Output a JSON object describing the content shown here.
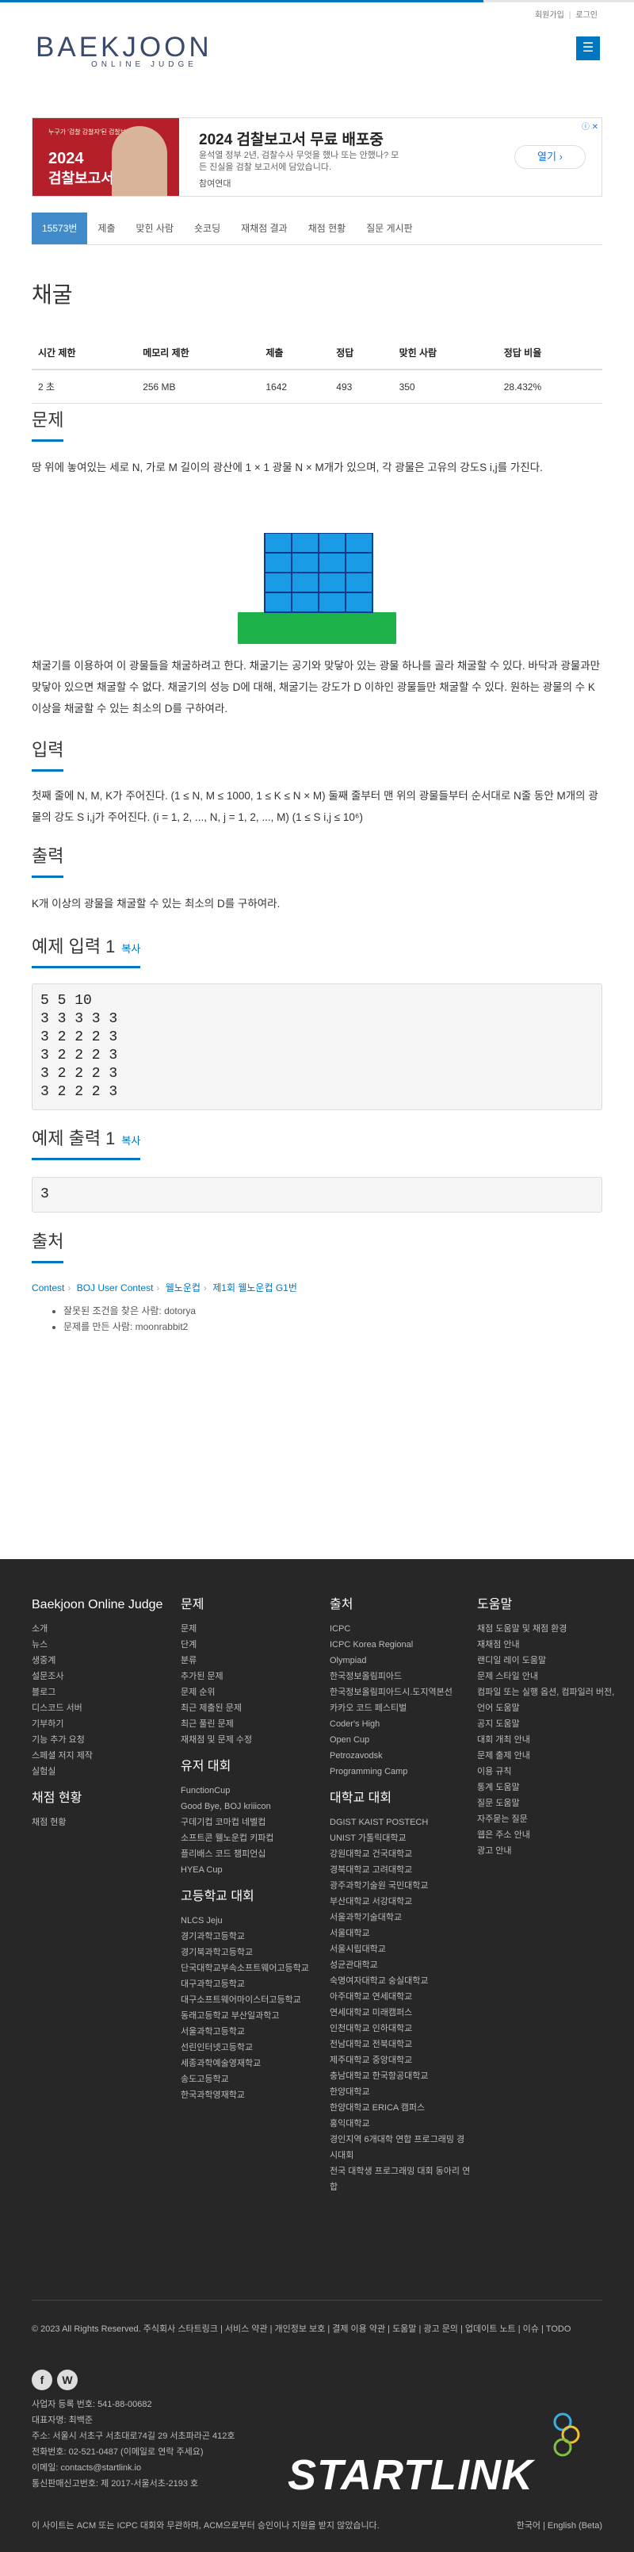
{
  "header": {
    "links": [
      "회원가입",
      "로그인"
    ],
    "logo": "BAEKJOON",
    "logo_sub": "ONLINE JUDGE",
    "menu_icon": "hamburger-icon"
  },
  "ad": {
    "img_small": "누구가 '검찰 감찰자'된 검찰보다",
    "img_line1": "2024",
    "img_line2": "검찰보고서",
    "title": "2024 검찰보고서 무료 배포중",
    "body": "윤석열 정부 2년, 검찰수사 무엇을 했나 또는 안했나? 모든 진실을 검찰 보고서에 담았습니다.",
    "source": "참여연대",
    "open_label": "열기",
    "close_label": "ⓘ ✕"
  },
  "tabs": [
    "15573번",
    "제출",
    "맞힌 사람",
    "숏코딩",
    "재채점 결과",
    "채점 현황",
    "질문 게시판"
  ],
  "problem": {
    "title": "채굴",
    "headers": [
      "시간 제한",
      "메모리 제한",
      "제출",
      "정답",
      "맞힌 사람",
      "정답 비율"
    ],
    "values": [
      "2 초",
      "256 MB",
      "1642",
      "493",
      "350",
      "28.432%"
    ]
  },
  "sections": {
    "problem_h": "문제",
    "problem_p1": "땅 위에 놓여있는 세로 N, 가로 M 길이의 광산에 1 × 1 광물 N × M개가 있으며, 각 광물은 고유의 강도S i,j를 가진다.",
    "problem_p2": "채굴기를 이용하여 이 광물들을 채굴하려고 한다. 채굴기는 공기와 맞닿아 있는 광물 하나를 골라 채굴할 수 있다. 바닥과 광물과만 맞닿아 있으면 채굴할 수 없다. 채굴기의 성능 D에 대해, 채굴기는 강도가 D 이하인 광물들만 채굴할 수 있다. 원하는 광물의 수 K 이상을 채굴할 수 있는 최소의 D를 구하여라.",
    "input_h": "입력",
    "input_p": "첫째 줄에 N, M, K가 주어진다. (1 ≤ N, M ≤ 1000, 1 ≤ K ≤ N × M) 둘째 줄부터 맨 위의 광물들부터 순서대로 N줄 동안 M개의 광물의 강도 S i,j가 주어진다. (i = 1, 2, ..., N, j = 1, 2, ..., M) (1 ≤ S i,j ≤ 10⁶)",
    "output_h": "출력",
    "output_p": "K개 이상의 광물을 채굴할 수 있는 최소의 D를 구하여라.",
    "sample_in_h": "예제 입력 1",
    "sample_in": "5 5 10\n3 3 3 3 3\n3 2 2 2 3\n3 2 2 2 3\n3 2 2 2 3\n3 2 2 2 3",
    "sample_out_h": "예제 출력 1",
    "sample_out": "3",
    "copy": "복사",
    "source_h": "출처",
    "source_path": [
      "Contest",
      "BOJ User Contest",
      "웰노운컵",
      "제1회 웰노운컵 G1번"
    ],
    "source_items": [
      "잘못된 조건을 찾은 사람: dotorya",
      "문제를 만든 사람: moonrabbit2"
    ]
  },
  "footer": {
    "col1_title": "Baekjoon Online Judge",
    "col1": [
      "소개",
      "뉴스",
      "생중계",
      "설문조사",
      "블로그",
      "디스코드 서버",
      "기부하기",
      "기능 추가 요청",
      "스페셜 저지 제작",
      "실험실"
    ],
    "col1b_title": "채점 현황",
    "col1b": [
      "채점 현황"
    ],
    "col2_title": "문제",
    "col2": [
      "문제",
      "단계",
      "분류",
      "추가된 문제",
      "문제 순위",
      "최근 제출된 문제",
      "최근 풀린 문제",
      "재채점 및 문제 수정"
    ],
    "col2b_title": "유저 대회",
    "col2b": [
      "FunctionCup",
      "Good Bye, BOJ kriiicon",
      "구데기컵 코마컵 네벨컵",
      "소프트콘 웰노운컵 키파컵",
      "플리배스 코드 챔피언십",
      "HYEA Cup"
    ],
    "col2c_title": "고등학교 대회",
    "col2c": [
      "NLCS Jeju",
      "경기과학고등학교",
      "경기북과학고등학교",
      "단국대학교부속소프트웨어고등학교",
      "대구과학고등학교",
      "대구소프트웨어마이스터고등학교",
      "동래고등학교 부산일과학고",
      "서울과학고등학교",
      "선린인터넷고등학교",
      "세종과학예술영재학교",
      "송도고등학교",
      "한국과학영재학교"
    ],
    "col3_title": "출처",
    "col3": [
      "ICPC",
      "ICPC Korea Regional",
      "Olympiad",
      "한국정보올림피아드",
      "한국정보올림피아드시.도지역본선",
      "카카오 코드 페스티벌",
      "Coder's High",
      "Open Cup",
      "Petrozavodsk",
      "Programming Camp"
    ],
    "col3b_title": "대학교 대회",
    "col3b": [
      "DGIST KAIST POSTECH",
      "UNIST 가톨릭대학교",
      "강원대학교 건국대학교",
      "경북대학교 고려대학교",
      "광주과학기술원 국민대학교",
      "부산대학교 서강대학교",
      "서울과학기술대학교",
      "서울대학교",
      "서울시립대학교",
      "성균관대학교",
      "숙명여자대학교 숭실대학교",
      "아주대학교 연세대학교",
      "연세대학교 미래캠퍼스",
      "인천대학교 인하대학교",
      "전남대학교 전북대학교",
      "제주대학교 중앙대학교",
      "충남대학교 한국항공대학교",
      "한양대학교",
      "한양대학교 ERICA 캠퍼스",
      "홍익대학교",
      "경인지역 6개대학 연합 프로그래밍 경시대회",
      "전국 대학생 프로그래밍 대회 동아리 연합"
    ],
    "col4_title": "도움말",
    "col4": [
      "채점 도움말 및 채점 환경",
      "재채점 안내",
      "랜디일 레이 도움말",
      "문제 스타일 안내",
      "컴파일 또는 실행 옵션, 컴파일러 버전, 언어 도움말",
      "공지 도움말",
      "대회 개최 안내",
      "문제 출제 안내",
      "이용 규칙",
      "통계 도움말",
      "질문 도움말",
      "자주묻는 질문",
      "웹은 주소 안내",
      "광고 안내"
    ],
    "bottom": "© 2023 All Rights Reserved. 주식회사 스타트링크 | 서비스 약관 | 개인정보 보호 | 결제 이용 약관 | 도움말 | 광고 문의 | 업데이트 노트 | 이슈 | TODO",
    "company": [
      "사업자 등록 번호: 541-88-00682",
      "대표자명: 최백준",
      "주소: 서울시 서초구 서초대로74길 29 서초파라곤 412호",
      "전화번호: 02-521-0487 (이메일로 연락 주세요)",
      "이메일: contacts@startlink.io",
      "통신판매신고번호: 제 2017-서울서초-2193 호"
    ],
    "brand": "STARTLINK",
    "fine": "이 사이트는 ACM 또는 ICPC 대회와 무관하며, ACM으로부터 승인이나 지원을 받지 않았습니다.",
    "lang": "한국어 | English (Beta)"
  }
}
